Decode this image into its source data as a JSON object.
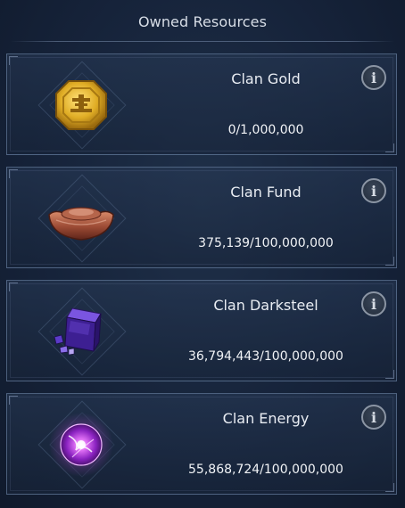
{
  "header": {
    "title": "Owned Resources"
  },
  "resources": [
    {
      "name": "Clan Gold",
      "value": "0/1,000,000",
      "icon": "clan-gold-coin-icon"
    },
    {
      "name": "Clan Fund",
      "value": "375,139/100,000,000",
      "icon": "clan-fund-ingot-icon"
    },
    {
      "name": "Clan Darksteel",
      "value": "36,794,443/100,000,000",
      "icon": "clan-darksteel-cube-icon"
    },
    {
      "name": "Clan Energy",
      "value": "55,868,724/100,000,000",
      "icon": "clan-energy-orb-icon"
    }
  ],
  "info_glyph": "i",
  "colors": {
    "background": "#16233a",
    "card_border": "#7891b4",
    "gold": "#e0b12a",
    "fund": "#a0513a",
    "darksteel": "#5a2fb0",
    "energy": "#b23ad6"
  }
}
